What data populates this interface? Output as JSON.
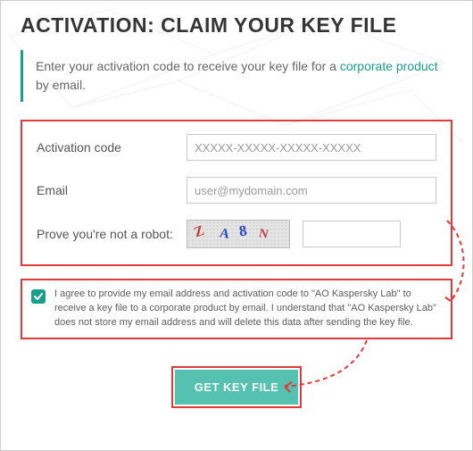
{
  "title": "ACTIVATION: CLAIM YOUR KEY FILE",
  "intro_prefix": "Enter your activation code to receive your key file for a ",
  "intro_link": "corporate product",
  "intro_suffix": " by email.",
  "fields": {
    "code_label": "Activation code",
    "code_placeholder": "XXXXX-XXXXX-XXXXX-XXXXX",
    "email_label": "Email",
    "email_placeholder": "user@mydomain.com",
    "captcha_label": "Prove you're not a robot:",
    "captcha_text": "ZA8N"
  },
  "consent": {
    "checked": true,
    "text": "I agree to provide my email address and activation code to \"AO Kaspersky Lab\" to receive a key file to a corporate product by email. I understand that \"AO Kaspersky Lab\" does not store my email address and will delete this data after sending the key file."
  },
  "button_label": "GET KEY FILE"
}
